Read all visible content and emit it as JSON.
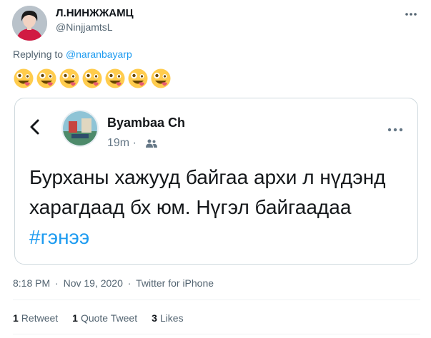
{
  "author": {
    "name": "Л.НИНЖЖАМЦ",
    "handle": "@NinjjamtsL",
    "more_icon": "more-horizontal-icon"
  },
  "reply": {
    "prefix": "Replying to ",
    "mention": "@naranbayarp"
  },
  "emoji_row": {
    "emoji": "zany-face",
    "count": 7
  },
  "embedded": {
    "back_icon": "chevron-left-icon",
    "name": "Byambaa Ch",
    "time": "19m ·",
    "audience_icon": "people-icon",
    "more_icon": "more-horizontal-icon",
    "text": "Бурханы хажууд байгаа архи л нүдэнд харагдаад бх юм. Нүгэл байгаадаа ",
    "hashtag": "#гэнээ"
  },
  "meta": {
    "time": "8:18 PM",
    "date": "Nov 19, 2020",
    "source": "Twitter for iPhone",
    "separator": "·"
  },
  "stats": {
    "retweets_count": "1",
    "retweets_label": "Retweet",
    "quotes_count": "1",
    "quotes_label": "Quote Tweet",
    "likes_count": "3",
    "likes_label": "Likes"
  },
  "colors": {
    "link": "#1d9bf0",
    "text": "#0f1419",
    "muted": "#536471",
    "border": "#cfd9de",
    "emoji_face": "#ffcc4d"
  }
}
